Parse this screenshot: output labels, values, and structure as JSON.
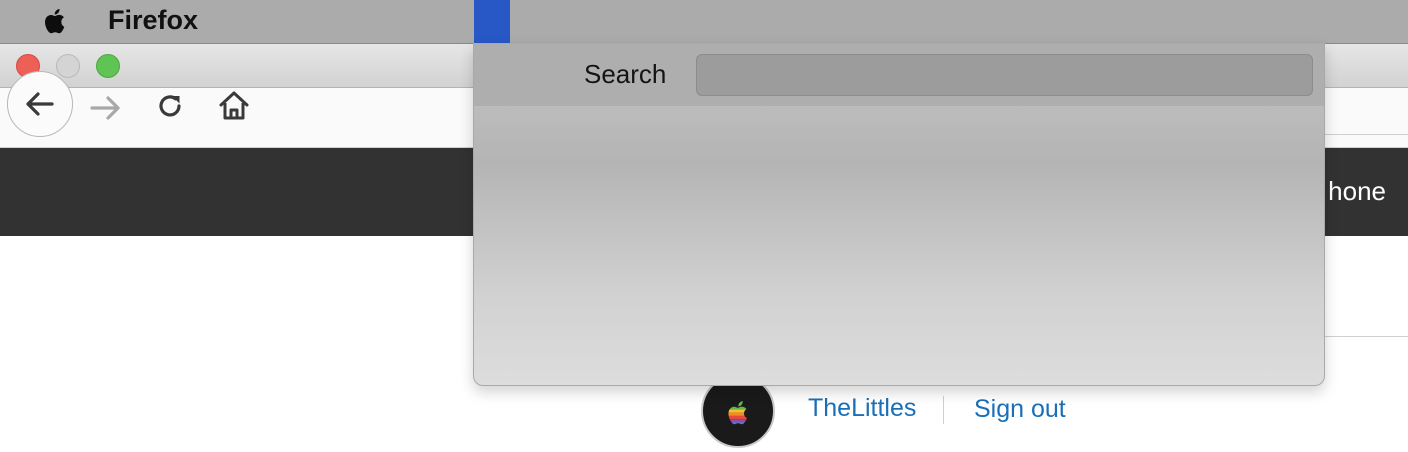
{
  "menubar": {
    "app_name": "Firefox",
    "apple_icon": "apple-logo-icon"
  },
  "window": {
    "controls": [
      "close",
      "minimize",
      "maximize"
    ]
  },
  "toolbar": {
    "icons": [
      "back-arrow-icon",
      "forward-arrow-icon",
      "reload-icon",
      "home-icon"
    ]
  },
  "page": {
    "nav_text": "hone",
    "user": {
      "name": "TheLittles",
      "sign_out": "Sign out"
    }
  },
  "search": {
    "label": "Search",
    "value": "",
    "placeholder": ""
  },
  "colors": {
    "menubar_highlight": "#2758c6",
    "link": "#1a6fb8",
    "dark_bar": "#323232"
  }
}
